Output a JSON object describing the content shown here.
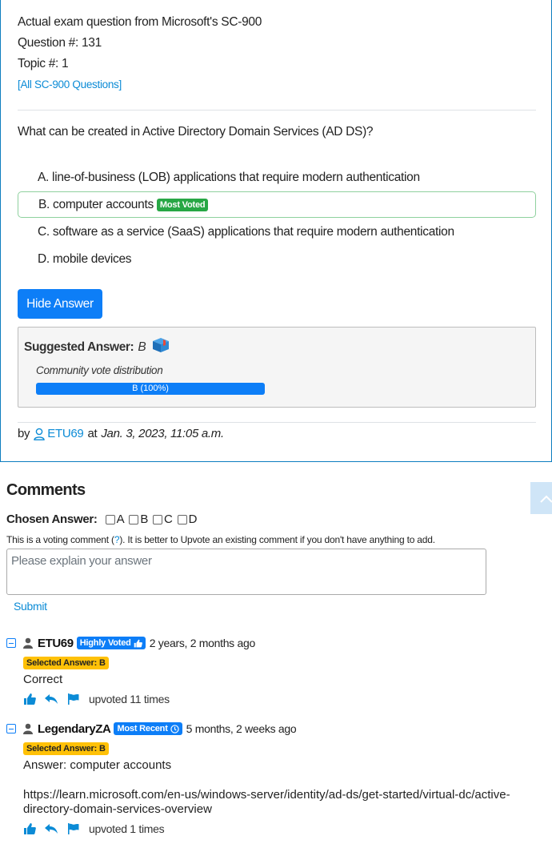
{
  "question": {
    "header": "Actual exam question from Microsoft's SC-900",
    "number_line": "Question #: 131",
    "topic_line": "Topic #: 1",
    "all_link": "[All SC-900 Questions]",
    "text": "What can be created in Active Directory Domain Services (AD DS)?",
    "choices": [
      {
        "label": "A. line-of-business (LOB) applications that require modern authentication"
      },
      {
        "label": "B. computer accounts",
        "badge": "Most Voted"
      },
      {
        "label": "C. software as a service (SaaS) applications that require modern authentication"
      },
      {
        "label": "D. mobile devices"
      }
    ],
    "hide_answer_button": "Hide Answer",
    "suggested_label": "Suggested Answer:",
    "suggested_value": "B",
    "vote_title": "Community vote distribution",
    "vote_bar_label": "B (100%)",
    "vote_bar_fraction": 1.0,
    "by_label": "by",
    "author": "ETU69",
    "at_label": "at",
    "date": "Jan. 3, 2023, 11:05 a.m."
  },
  "comments_section": {
    "title": "Comments",
    "chosen_label": "Chosen Answer:",
    "options": [
      "A",
      "B",
      "C",
      "D"
    ],
    "note_before": "This is a voting comment (",
    "note_link": "?",
    "note_after": "). It is better to Upvote an existing comment if you don't have anything to add.",
    "placeholder": "Please explain your answer",
    "submit_label": "Submit"
  },
  "comments": [
    {
      "user": "ETU69",
      "badge": "Highly Voted",
      "ago": "2 years, 2 months ago",
      "selected": "Selected Answer: B",
      "body": [
        "Correct"
      ],
      "upvotes": "upvoted 11 times"
    },
    {
      "user": "LegendaryZA",
      "badge": "Most Recent",
      "ago": "5 months, 2 weeks ago",
      "selected": "Selected Answer: B",
      "body": [
        "Answer: computer accounts",
        "https://learn.microsoft.com/en-us/windows-server/identity/ad-ds/get-started/virtual-dc/active-directory-domain-services-overview"
      ],
      "upvotes": "upvoted 1 times"
    }
  ],
  "colors": {
    "primary": "#0d7ef7",
    "link": "#0b8bd6",
    "success": "#28a745",
    "warning": "#ffc107",
    "card_border": "#0d7dbf"
  }
}
